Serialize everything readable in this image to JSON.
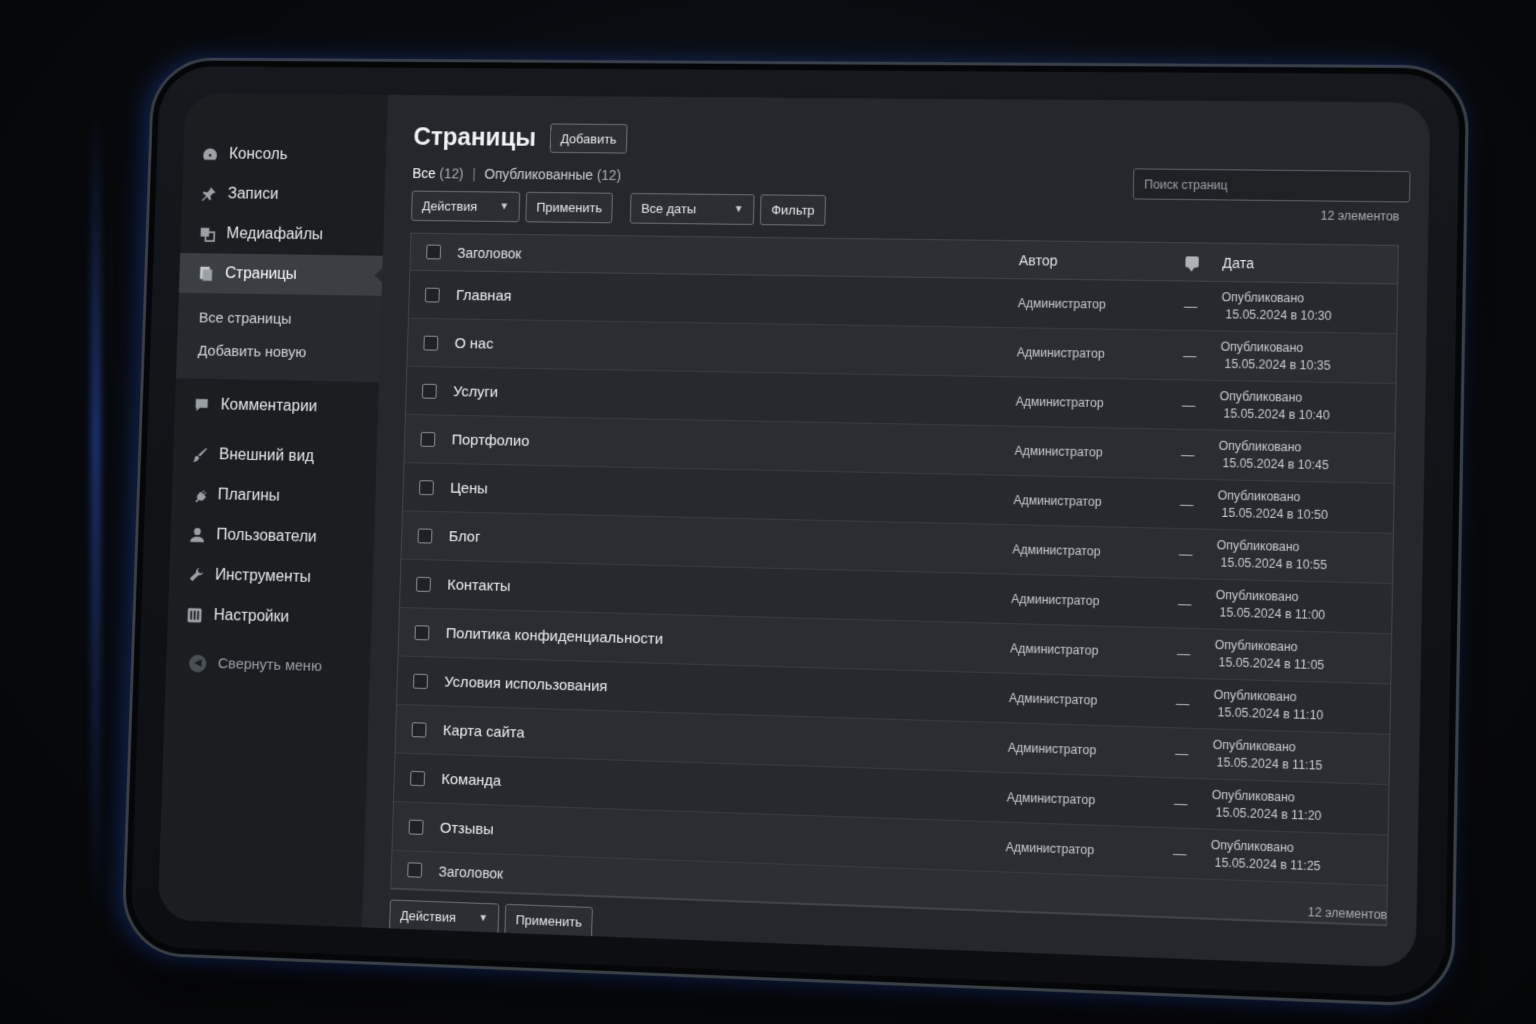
{
  "sidebar": {
    "items": [
      {
        "label": "Консоль",
        "icon": "dashboard-icon"
      },
      {
        "label": "Записи",
        "icon": "pin-icon"
      },
      {
        "label": "Медиафайлы",
        "icon": "media-icon"
      },
      {
        "label": "Страницы",
        "icon": "pages-icon"
      }
    ],
    "submenu": [
      {
        "label": "Все страницы"
      },
      {
        "label": "Добавить новую"
      }
    ],
    "items2": [
      {
        "label": "Комментарии",
        "icon": "comment-icon"
      },
      {
        "label": "Внешний вид",
        "icon": "brush-icon"
      },
      {
        "label": "Плагины",
        "icon": "plugin-icon"
      },
      {
        "label": "Пользователи",
        "icon": "user-icon"
      },
      {
        "label": "Инструменты",
        "icon": "wrench-icon"
      },
      {
        "label": "Настройки",
        "icon": "settings-icon"
      }
    ],
    "collapse_label": "Свернуть меню"
  },
  "main": {
    "title": "Страницы",
    "add_button": "Добавить",
    "filters": {
      "all": "Все",
      "all_count": "(12)",
      "published": "Опубликованные",
      "published_count": "(12)"
    },
    "search_placeholder": "Поиск страниц",
    "toolbar": {
      "actions": "Действия",
      "apply": "Применить",
      "dates": "Все даты",
      "filter": "Фильтр"
    },
    "count_label": "12 элементов",
    "columns": {
      "title": "Заголовок",
      "author": "Автор",
      "date": "Дата"
    },
    "rows": [
      {
        "title": "Главная",
        "author": "Администратор",
        "comments": "—",
        "status": "Опубликовано",
        "date": "15.05.2024 в 10:30"
      },
      {
        "title": "О нас",
        "author": "Администратор",
        "comments": "—",
        "status": "Опубликовано",
        "date": "15.05.2024 в 10:35"
      },
      {
        "title": "Услуги",
        "author": "Администратор",
        "comments": "—",
        "status": "Опубликовано",
        "date": "15.05.2024 в 10:40"
      },
      {
        "title": "Портфолио",
        "author": "Администратор",
        "comments": "—",
        "status": "Опубликовано",
        "date": "15.05.2024 в 10:45"
      },
      {
        "title": "Цены",
        "author": "Администратор",
        "comments": "—",
        "status": "Опубликовано",
        "date": "15.05.2024 в 10:50"
      },
      {
        "title": "Блог",
        "author": "Администратор",
        "comments": "—",
        "status": "Опубликовано",
        "date": "15.05.2024 в 10:55"
      },
      {
        "title": "Контакты",
        "author": "Администратор",
        "comments": "—",
        "status": "Опубликовано",
        "date": "15.05.2024 в 11:00"
      },
      {
        "title": "Политика конфиденциальности",
        "author": "Администратор",
        "comments": "—",
        "status": "Опубликовано",
        "date": "15.05.2024 в 11:05"
      },
      {
        "title": "Условия использования",
        "author": "Администратор",
        "comments": "—",
        "status": "Опубликовано",
        "date": "15.05.2024 в 11:10"
      },
      {
        "title": "Карта сайта",
        "author": "Администратор",
        "comments": "—",
        "status": "Опубликовано",
        "date": "15.05.2024 в 11:15"
      },
      {
        "title": "Команда",
        "author": "Администратор",
        "comments": "—",
        "status": "Опубликовано",
        "date": "15.05.2024 в 11:20"
      },
      {
        "title": "Отзывы",
        "author": "Администратор",
        "comments": "—",
        "status": "Опубликовано",
        "date": "15.05.2024 в 11:25"
      }
    ],
    "footer_title": "Заголовок",
    "bottom_toolbar": {
      "actions": "Действия",
      "apply": "Применить"
    }
  },
  "colors": {
    "background": "#07090c",
    "sidebar": "#1b1d20",
    "content": "#24272b",
    "active_menu": "#3b3f44",
    "edge_glow": "#3c6eff"
  }
}
